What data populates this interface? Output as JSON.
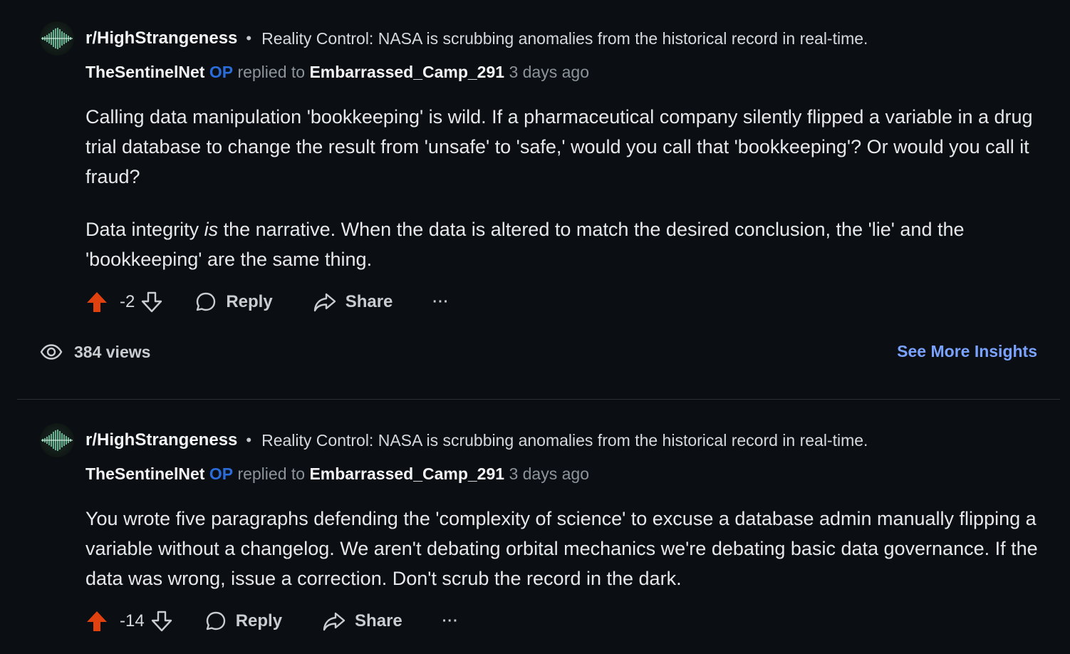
{
  "comments": [
    {
      "subreddit": "r/HighStrangeness",
      "separator": "•",
      "post_title": "Reality Control: NASA is scrubbing anomalies from the historical record in real-time.",
      "author": "TheSentinelNet",
      "op_badge": "OP",
      "replied_to_label": "replied to",
      "replied_to_user": "Embarrassed_Camp_291",
      "time": "3 days ago",
      "paragraphs": [
        "Calling data manipulation 'bookkeeping' is wild. If a pharmaceutical company silently flipped a variable in a drug trial database to change the result from 'unsafe' to 'safe,' would you call that 'bookkeeping'? Or would you call it fraud?",
        "Data integrity is the narrative. When the data is altered to match the desired conclusion, the 'lie' and the 'bookkeeping' are the same thing."
      ],
      "p2_prefix": "Data integrity ",
      "p2_em": "is",
      "p2_suffix": " the narrative. When the data is altered to match the desired conclusion, the 'lie' and the 'bookkeeping' are the same thing.",
      "score": "-2",
      "reply_label": "Reply",
      "share_label": "Share",
      "more_label": "···"
    },
    {
      "subreddit": "r/HighStrangeness",
      "separator": "•",
      "post_title": "Reality Control: NASA is scrubbing anomalies from the historical record in real-time.",
      "author": "TheSentinelNet",
      "op_badge": "OP",
      "replied_to_label": "replied to",
      "replied_to_user": "Embarrassed_Camp_291",
      "time": "3 days ago",
      "paragraphs": [
        "You wrote five paragraphs defending the 'complexity of science' to excuse a database admin manually flipping a variable without a changelog. We aren't debating orbital mechanics we're debating basic data governance. If the data was wrong, issue a correction. Don't scrub the record in the dark."
      ],
      "score": "-14",
      "reply_label": "Reply",
      "share_label": "Share",
      "more_label": "···"
    }
  ],
  "insights": {
    "views": "384 views",
    "link": "See More Insights"
  },
  "colors": {
    "background": "#0b0e12",
    "op_badge": "#2b6cdb",
    "upvote": "#e0410f",
    "link": "#7aa2ff"
  },
  "icons": [
    "avatar-waveform",
    "upvote-icon",
    "downvote-icon",
    "reply-bubble-icon",
    "share-arrow-icon",
    "more-dots-icon",
    "eye-icon"
  ]
}
